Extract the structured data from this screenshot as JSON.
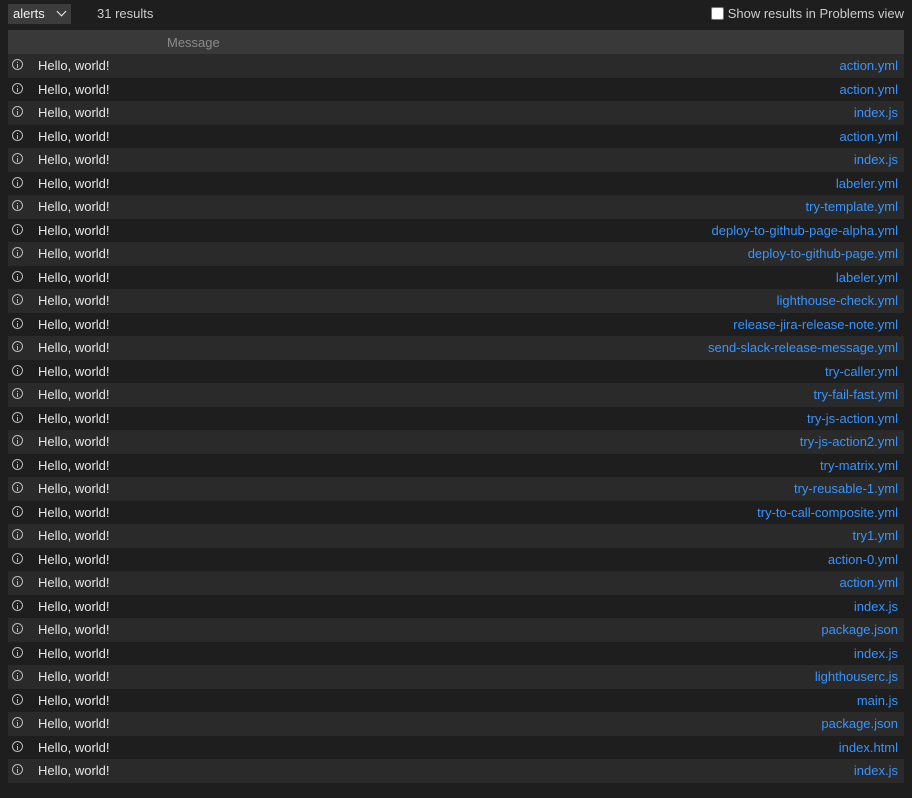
{
  "toolbar": {
    "select_value": "alerts",
    "result_count": "31 results",
    "problems_label": "Show results in Problems view"
  },
  "table": {
    "column_message": "Message",
    "rows": [
      {
        "message": "Hello, world!",
        "file": "action.yml"
      },
      {
        "message": "Hello, world!",
        "file": "action.yml"
      },
      {
        "message": "Hello, world!",
        "file": "index.js"
      },
      {
        "message": "Hello, world!",
        "file": "action.yml"
      },
      {
        "message": "Hello, world!",
        "file": "index.js"
      },
      {
        "message": "Hello, world!",
        "file": "labeler.yml"
      },
      {
        "message": "Hello, world!",
        "file": "try-template.yml"
      },
      {
        "message": "Hello, world!",
        "file": "deploy-to-github-page-alpha.yml"
      },
      {
        "message": "Hello, world!",
        "file": "deploy-to-github-page.yml"
      },
      {
        "message": "Hello, world!",
        "file": "labeler.yml"
      },
      {
        "message": "Hello, world!",
        "file": "lighthouse-check.yml"
      },
      {
        "message": "Hello, world!",
        "file": "release-jira-release-note.yml"
      },
      {
        "message": "Hello, world!",
        "file": "send-slack-release-message.yml"
      },
      {
        "message": "Hello, world!",
        "file": "try-caller.yml"
      },
      {
        "message": "Hello, world!",
        "file": "try-fail-fast.yml"
      },
      {
        "message": "Hello, world!",
        "file": "try-js-action.yml"
      },
      {
        "message": "Hello, world!",
        "file": "try-js-action2.yml"
      },
      {
        "message": "Hello, world!",
        "file": "try-matrix.yml"
      },
      {
        "message": "Hello, world!",
        "file": "try-reusable-1.yml"
      },
      {
        "message": "Hello, world!",
        "file": "try-to-call-composite.yml"
      },
      {
        "message": "Hello, world!",
        "file": "try1.yml"
      },
      {
        "message": "Hello, world!",
        "file": "action-0.yml"
      },
      {
        "message": "Hello, world!",
        "file": "action.yml"
      },
      {
        "message": "Hello, world!",
        "file": "index.js"
      },
      {
        "message": "Hello, world!",
        "file": "package.json"
      },
      {
        "message": "Hello, world!",
        "file": "index.js"
      },
      {
        "message": "Hello, world!",
        "file": "lighthouserc.js"
      },
      {
        "message": "Hello, world!",
        "file": "main.js"
      },
      {
        "message": "Hello, world!",
        "file": "package.json"
      },
      {
        "message": "Hello, world!",
        "file": "index.html"
      },
      {
        "message": "Hello, world!",
        "file": "index.js"
      }
    ]
  },
  "icons": {
    "row_icon": "info-icon",
    "select_icon": "chevron-down-icon"
  },
  "colors": {
    "link": "#3794ff",
    "background": "#1e1e1e",
    "row_alt": "#2a2a2a",
    "header": "#393939"
  }
}
